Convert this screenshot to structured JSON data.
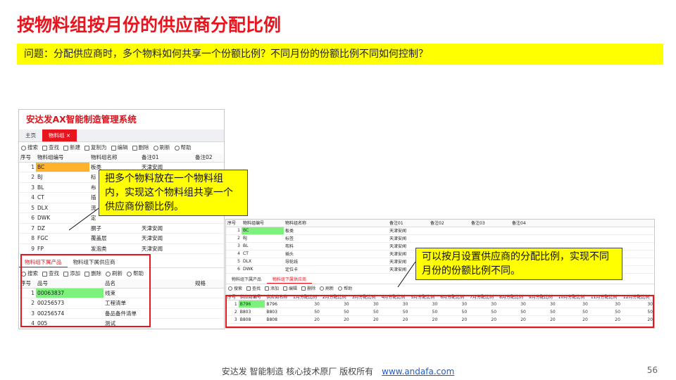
{
  "slide": {
    "title": "按物料组按月份的供应商分配比例",
    "question": "问题：分配供应商时，多个物料如何共享一个份额比例？不同月份的份额比例不同如何控制？",
    "callout1": "把多个物料放在一个物料组内，实现这个物料组共享一个供应商份额比例。",
    "callout2": "可以按月设置供应商的分配比例，实现不同月份的份额比例不同。",
    "footer_text": "安达发   智能制造 核心技术原厂   版权所有",
    "footer_link": "www.andafa.com",
    "page_number": "56",
    "accent_color": "#e8141e",
    "highlight_color": "#ffff00"
  },
  "app": {
    "title": "安达发AX智能制造管理系统",
    "tabs": [
      "主页",
      "物料组"
    ],
    "close_glyph": "×",
    "toolbar": [
      "搜索",
      "查找",
      "新建",
      "复制为",
      "编辑",
      "删除",
      "刷新",
      "帮助"
    ],
    "group_columns": [
      "序号",
      "物料组编号",
      "物料组名称",
      "备注01",
      "备注02"
    ],
    "groups": [
      {
        "no": "1",
        "code": "BC",
        "name": "板类",
        "note1": "天津安闻"
      },
      {
        "no": "2",
        "code": "BJ",
        "name": "标",
        "note1": ""
      },
      {
        "no": "3",
        "code": "BL",
        "name": "布",
        "note1": ""
      },
      {
        "no": "4",
        "code": "CT",
        "name": "插",
        "note1": ""
      },
      {
        "no": "5",
        "code": "DLX",
        "name": "流",
        "note1": ""
      },
      {
        "no": "6",
        "code": "DWK",
        "name": "定",
        "note1": ""
      },
      {
        "no": "7",
        "code": "DZ",
        "name": "胴子",
        "note1": "天津安闻"
      },
      {
        "no": "8",
        "code": "FGC",
        "name": "覆盖层",
        "note1": "天津安闻"
      },
      {
        "no": "9",
        "code": "FP",
        "name": "发泡类",
        "note1": "天津安闻"
      }
    ],
    "subtabs": [
      "物料组下属产品",
      "物料组下属供应商"
    ],
    "sub_toolbar": [
      "搜索",
      "查找",
      "添加",
      "删除",
      "刷新",
      "帮助"
    ],
    "product_columns": [
      "序号",
      "品号",
      "品名",
      "规格"
    ],
    "products": [
      {
        "no": "1",
        "code": "00063837",
        "name": "线束",
        "spec": ""
      },
      {
        "no": "2",
        "code": "00256573",
        "name": "工程清单",
        "spec": ""
      },
      {
        "no": "3",
        "code": "00256574",
        "name": "备品备件清单",
        "spec": ""
      },
      {
        "no": "4",
        "code": "005",
        "name": "测试",
        "spec": ""
      }
    ]
  },
  "app2": {
    "group_columns": [
      "序号",
      "物料组编号",
      "物料组名称",
      "备注01",
      "备注02",
      "备注03",
      "备注04"
    ],
    "groups": [
      {
        "no": "1",
        "code": "BC",
        "name": "板类",
        "note1": "天津安闻"
      },
      {
        "no": "2",
        "code": "BJ",
        "name": "标签",
        "note1": "天津安闻"
      },
      {
        "no": "3",
        "code": "BL",
        "name": "布料",
        "note1": "天津安闻"
      },
      {
        "no": "4",
        "code": "CT",
        "name": "插头",
        "note1": "天津安闻"
      },
      {
        "no": "5",
        "code": "DLX",
        "name": "导轮线",
        "note1": "天津安闻"
      },
      {
        "no": "6",
        "code": "DWK",
        "name": "定位卡",
        "note1": "天津安闻"
      }
    ],
    "subtabs": [
      "物料组下属产品",
      "物料组下属供应商"
    ],
    "toolbar": [
      "搜索",
      "查找",
      "添加",
      "编辑",
      "删除",
      "刷新",
      "帮助"
    ],
    "supplier_columns": [
      "序号",
      "供应商编号",
      "供应商名称",
      "1月分配比例",
      "2月分配比例",
      "3月分配比例",
      "4月分配比例",
      "5月分配比例",
      "6月分配比例",
      "7月分配比例",
      "8月分配比例",
      "9月分配比例",
      "10月分配比例",
      "11月分配比例",
      "12月分配比例"
    ],
    "suppliers": [
      {
        "no": "1",
        "code": "B796",
        "name": "B796",
        "ratios": [
          "30",
          "30",
          "30",
          "30",
          "30",
          "30",
          "30",
          "30",
          "30",
          "30",
          "30",
          "30"
        ]
      },
      {
        "no": "2",
        "code": "B803",
        "name": "B803",
        "ratios": [
          "50",
          "50",
          "50",
          "50",
          "50",
          "50",
          "50",
          "50",
          "50",
          "50",
          "50",
          "50"
        ]
      },
      {
        "no": "3",
        "code": "B808",
        "name": "B808",
        "ratios": [
          "20",
          "20",
          "20",
          "20",
          "20",
          "20",
          "20",
          "20",
          "20",
          "20",
          "20",
          "20"
        ]
      }
    ]
  }
}
